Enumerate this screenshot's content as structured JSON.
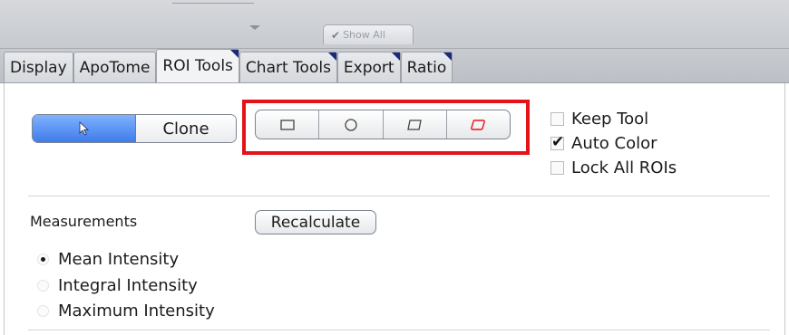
{
  "toolbar": {
    "show_all_label": "Show All"
  },
  "tabs": [
    {
      "label": "Display",
      "active": false,
      "has_corner": false
    },
    {
      "label": "ApoTome",
      "active": false,
      "has_corner": false
    },
    {
      "label": "ROI Tools",
      "active": true,
      "has_corner": true
    },
    {
      "label": "Chart Tools",
      "active": false,
      "has_corner": true
    },
    {
      "label": "Export",
      "active": false,
      "has_corner": true
    },
    {
      "label": "Ratio",
      "active": false,
      "has_corner": true
    }
  ],
  "roi_tools": {
    "pointer_icon": "arrow-pointer-icon",
    "clone_label": "Clone",
    "shapes": [
      {
        "icon": "rectangle-icon",
        "color": "#444444"
      },
      {
        "icon": "circle-icon",
        "color": "#444444"
      },
      {
        "icon": "polygon-icon",
        "color": "#444444"
      },
      {
        "icon": "freehand-icon",
        "color": "#e4131a"
      }
    ],
    "options": {
      "keep_tool": {
        "label": "Keep Tool",
        "checked": false
      },
      "auto_color": {
        "label": "Auto Color",
        "checked": true
      },
      "lock_all_rois": {
        "label": "Lock All ROIs",
        "checked": false
      }
    }
  },
  "measurements": {
    "label": "Measurements",
    "recalculate_label": "Recalculate",
    "options": [
      {
        "label": "Mean Intensity",
        "selected": true
      },
      {
        "label": "Integral Intensity",
        "selected": false
      },
      {
        "label": "Maximum Intensity",
        "selected": false
      }
    ]
  },
  "colors": {
    "highlight": "#e4131a",
    "accent": "#3f7bea",
    "tab_corner": "#1a2a7c"
  }
}
